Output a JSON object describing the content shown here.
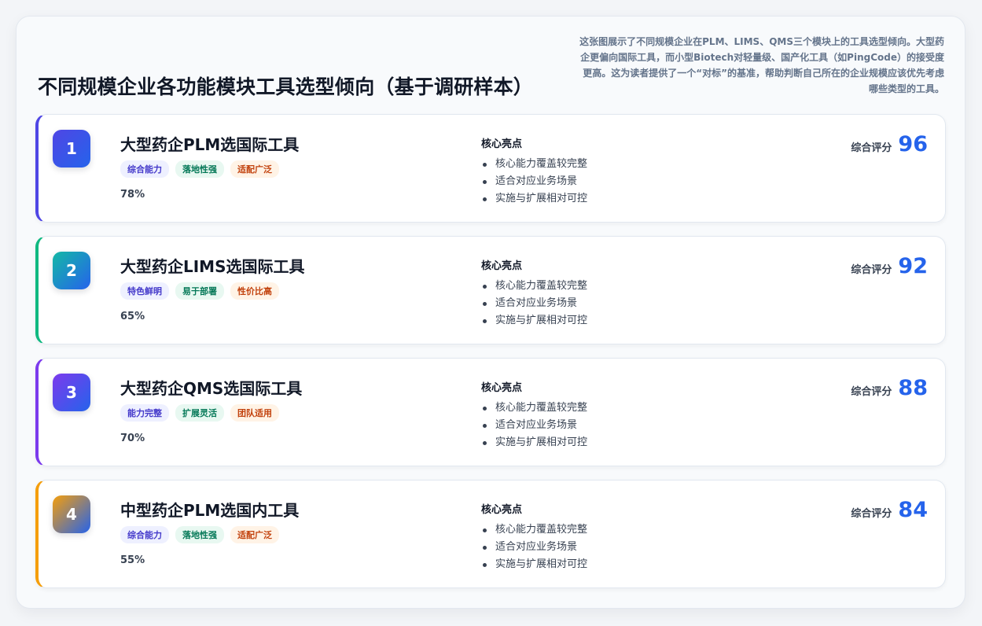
{
  "header": {
    "title": "不同规模企业各功能模块工具选型倾向（基于调研样本）",
    "description": "这张图展示了不同规模企业在PLM、LIMS、QMS三个模块上的工具选型倾向。大型药企更偏向国际工具，而小型Biotech对轻量级、国产化工具（如PingCode）的接受度更高。这为读者提供了一个“对标”的基准，帮助判断自己所在的企业规模应该优先考虑哪些类型的工具。"
  },
  "items": [
    {
      "rank": "1",
      "title": "大型药企PLM选国际工具",
      "tags": [
        "综合能力",
        "落地性强",
        "适配广泛"
      ],
      "percent": "78%",
      "highlights_title": "核心亮点",
      "highlights": [
        "核心能力覆盖较完整",
        "适合对应业务场景",
        "实施与扩展相对可控"
      ],
      "score_label": "综合评分",
      "score": "96",
      "accent": "#4f46e5",
      "badge_gradient": [
        "#4f46e5",
        "#2563eb"
      ]
    },
    {
      "rank": "2",
      "title": "大型药企LIMS选国际工具",
      "tags": [
        "特色鲜明",
        "易于部署",
        "性价比高"
      ],
      "percent": "65%",
      "highlights_title": "核心亮点",
      "highlights": [
        "核心能力覆盖较完整",
        "适合对应业务场景",
        "实施与扩展相对可控"
      ],
      "score_label": "综合评分",
      "score": "92",
      "accent": "#10b981",
      "badge_gradient": [
        "#14b8a6",
        "#2563eb"
      ]
    },
    {
      "rank": "3",
      "title": "大型药企QMS选国际工具",
      "tags": [
        "能力完整",
        "扩展灵活",
        "团队适用"
      ],
      "percent": "70%",
      "highlights_title": "核心亮点",
      "highlights": [
        "核心能力覆盖较完整",
        "适合对应业务场景",
        "实施与扩展相对可控"
      ],
      "score_label": "综合评分",
      "score": "88",
      "accent": "#7c3aed",
      "badge_gradient": [
        "#7c3aed",
        "#2563eb"
      ]
    },
    {
      "rank": "4",
      "title": "中型药企PLM选国内工具",
      "tags": [
        "综合能力",
        "落地性强",
        "适配广泛"
      ],
      "percent": "55%",
      "highlights_title": "核心亮点",
      "highlights": [
        "核心能力覆盖较完整",
        "适合对应业务场景",
        "实施与扩展相对可控"
      ],
      "score_label": "综合评分",
      "score": "84",
      "accent": "#f59e0b",
      "badge_gradient": [
        "#f59e0b",
        "#2563eb"
      ]
    }
  ]
}
